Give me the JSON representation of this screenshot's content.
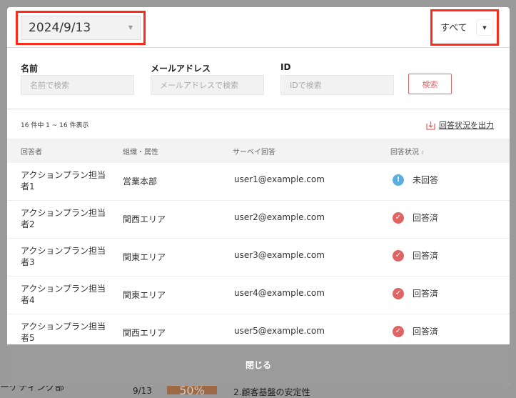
{
  "background": {
    "dept": "ーケティング部",
    "date": "9/13",
    "percent": "50%",
    "item": "2.顧客基盤の安定性"
  },
  "header": {
    "date_select": "2024/9/13",
    "filter_select": "すべて"
  },
  "filters": {
    "name_label": "名前",
    "name_placeholder": "名前で検索",
    "email_label": "メールアドレス",
    "email_placeholder": "メールアドレスで検索",
    "id_label": "ID",
    "id_placeholder": "IDで検索",
    "search_button": "検索"
  },
  "summary": {
    "count_text": "16 件中 1 ~ 16 件表示",
    "export_link": "回答状況を出力"
  },
  "table": {
    "headers": [
      "回答者",
      "組織・属性",
      "サーベイ回答",
      "回答状況"
    ],
    "rows": [
      {
        "name": "アクションプラン担当者1",
        "org": "営業本部",
        "email": "user1@example.com",
        "status": "未回答",
        "status_type": "pending"
      },
      {
        "name": "アクションプラン担当者2",
        "org": "関西エリア",
        "email": "user2@example.com",
        "status": "回答済",
        "status_type": "done"
      },
      {
        "name": "アクションプラン担当者3",
        "org": "関東エリア",
        "email": "user3@example.com",
        "status": "回答済",
        "status_type": "done"
      },
      {
        "name": "アクションプラン担当者4",
        "org": "関東エリア",
        "email": "user4@example.com",
        "status": "回答済",
        "status_type": "done"
      },
      {
        "name": "アクションプラン担当者5",
        "org": "関西エリア",
        "email": "user5@example.com",
        "status": "回答済",
        "status_type": "done"
      }
    ]
  },
  "footer": {
    "close_button": "閉じる"
  },
  "colors": {
    "highlight": "#ff2a1a",
    "accent": "#e06a6a",
    "pending": "#5aaee0",
    "done": "#e06464"
  }
}
